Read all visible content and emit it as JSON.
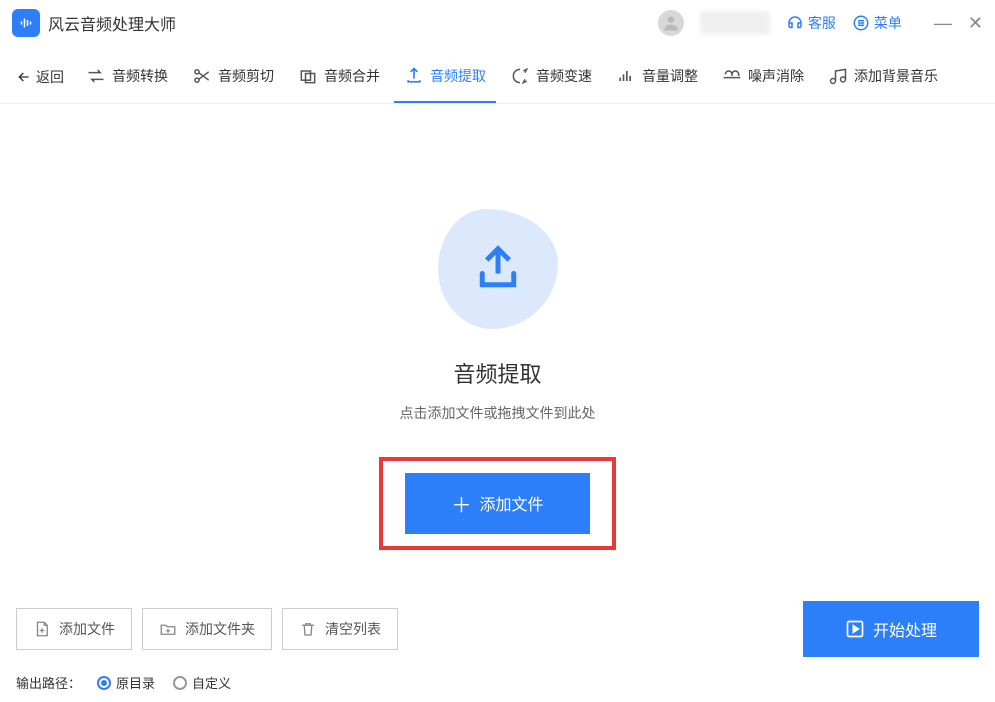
{
  "app": {
    "title": "风云音频处理大师"
  },
  "titleBar": {
    "customerService": "客服",
    "menu": "菜单"
  },
  "toolbar": {
    "back": "返回",
    "tabs": [
      {
        "label": "音频转换"
      },
      {
        "label": "音频剪切"
      },
      {
        "label": "音频合并"
      },
      {
        "label": "音频提取",
        "active": true
      },
      {
        "label": "音频变速"
      },
      {
        "label": "音量调整"
      },
      {
        "label": "噪声消除"
      },
      {
        "label": "添加背景音乐"
      }
    ]
  },
  "main": {
    "title": "音频提取",
    "subtitle": "点击添加文件或拖拽文件到此处",
    "addFileBtn": "添加文件"
  },
  "footer": {
    "addFile": "添加文件",
    "addFolder": "添加文件夹",
    "clearList": "清空列表",
    "start": "开始处理",
    "outputPathLabel": "输出路径：",
    "radioOriginal": "原目录",
    "radioCustom": "自定义"
  }
}
